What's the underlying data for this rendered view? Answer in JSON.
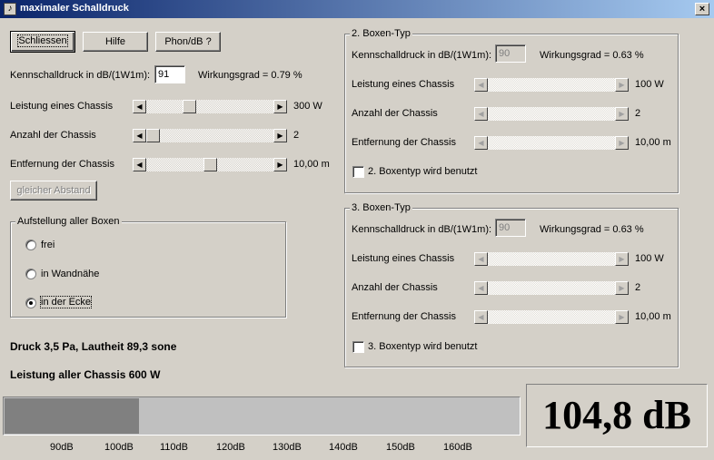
{
  "window": {
    "title": "maximaler Schalldruck",
    "close_label": "×"
  },
  "buttons": {
    "schliessen": "Schliessen",
    "hilfe": "Hilfe",
    "phon": "Phon/dB ?",
    "gleicher_abstand": "gleicher Abstand"
  },
  "box1": {
    "kennschalldruck_label": "Kennschalldruck in dB/(1W1m):",
    "kennschalldruck_value": "91",
    "wirkungsgrad": "Wirkungsgrad = 0.79 %",
    "leistung_label": "Leistung eines Chassis",
    "leistung_value": "300 W",
    "leistung_level": 0.32,
    "anzahl_label": "Anzahl der Chassis",
    "anzahl_value": "2",
    "anzahl_level": 0.0,
    "entfernung_label": "Entfernung der Chassis",
    "entfernung_value": "10,00 m",
    "entfernung_level": 0.5
  },
  "aufstellung": {
    "title": "Aufstellung aller Boxen",
    "options": [
      "frei",
      "in Wandnähe",
      "in der Ecke"
    ],
    "selected": 2
  },
  "results": {
    "druck": "Druck 3,5 Pa, Lautheit 89,3 sone",
    "leistung_total": "Leistung aller Chassis 600 W"
  },
  "box2": {
    "title": "2. Boxen-Typ",
    "kennschalldruck_label": "Kennschalldruck in dB/(1W1m):",
    "kennschalldruck_value": "90",
    "wirkungsgrad": "Wirkungsgrad = 0.63 %",
    "leistung_label": "Leistung eines Chassis",
    "leistung_value": "100 W",
    "anzahl_label": "Anzahl der Chassis",
    "anzahl_value": "2",
    "entfernung_label": "Entfernung der Chassis",
    "entfernung_value": "10,00 m",
    "checkbox_label": "2. Boxentyp wird benutzt",
    "checked": false
  },
  "box3": {
    "title": "3. Boxen-Typ",
    "kennschalldruck_label": "Kennschalldruck in dB/(1W1m):",
    "kennschalldruck_value": "90",
    "wirkungsgrad": "Wirkungsgrad = 0.63 %",
    "leistung_label": "Leistung eines Chassis",
    "leistung_value": "100 W",
    "anzahl_label": "Anzahl der Chassis",
    "anzahl_value": "2",
    "entfernung_label": "Entfernung der Chassis",
    "entfernung_value": "10,00 m",
    "checkbox_label": "3. Boxentyp wird benutzt",
    "checked": false
  },
  "meter": {
    "ticks": [
      "90dB",
      "100dB",
      "110dB",
      "120dB",
      "130dB",
      "140dB",
      "150dB",
      "160dB"
    ],
    "fill_fraction": 0.26,
    "db_readout": "104,8 dB"
  },
  "colors": {
    "title_start": "#0a246a",
    "title_end": "#a6caf0",
    "face": "#d4d0c8",
    "meter_fill": "#808080",
    "meter_track": "#c0c0c0"
  }
}
